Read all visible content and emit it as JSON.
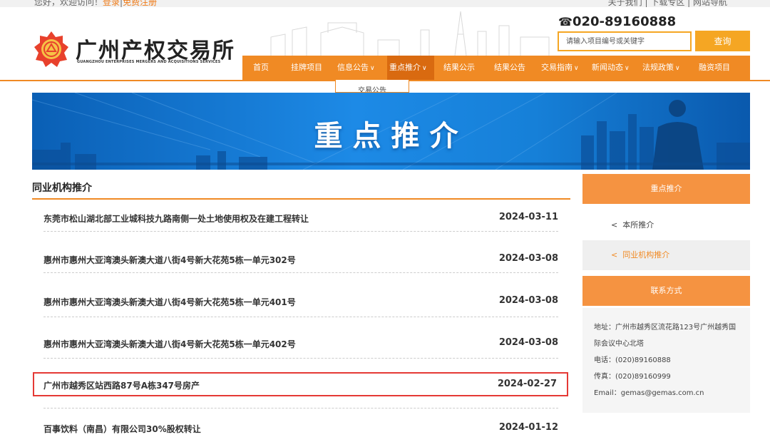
{
  "topbar": {
    "left_text": "您好，欢迎访问！",
    "left_link1": "登录",
    "left_sep": "|",
    "left_link2": "免费注册",
    "right_text": "关于我们 | 下载专区 | 网站导航"
  },
  "logo": {
    "name": "广州产权交易所",
    "subtitle": "GUANGZHOU ENTERPRISES MERGERS AND ACQUISITIONS SERVICES"
  },
  "header": {
    "phone_icon": "phone-icon",
    "phone": "020-89160888",
    "search_placeholder": "请输入项目编号或关键字",
    "search_button": "查询"
  },
  "nav": {
    "items": [
      {
        "label": "首页",
        "dropdown": false
      },
      {
        "label": "挂牌项目",
        "dropdown": false
      },
      {
        "label": "信息公告",
        "dropdown": true
      },
      {
        "label": "重点推介",
        "dropdown": true,
        "active": true
      },
      {
        "label": "结果公示",
        "dropdown": false
      },
      {
        "label": "结果公告",
        "dropdown": false
      },
      {
        "label": "交易指南",
        "dropdown": true
      },
      {
        "label": "新闻动态",
        "dropdown": true
      },
      {
        "label": "法规政策",
        "dropdown": true
      },
      {
        "label": "融资项目",
        "dropdown": false
      }
    ],
    "dropdown_item": "交易公告",
    "chevron": "∨"
  },
  "banner": {
    "title": "重点推介"
  },
  "section": {
    "title": "同业机构推介"
  },
  "list": {
    "items": [
      {
        "title": "东莞市松山湖北部工业城科技九路南侧一处土地使用权及在建工程转让",
        "date": "2024-03-11"
      },
      {
        "title": "惠州市惠州大亚湾澳头新澳大道八街4号新大花苑5栋一单元302号",
        "date": "2024-03-08"
      },
      {
        "title": "惠州市惠州大亚湾澳头新澳大道八街4号新大花苑5栋一单元401号",
        "date": "2024-03-08"
      },
      {
        "title": "惠州市惠州大亚湾澳头新澳大道八街4号新大花苑5栋一单元402号",
        "date": "2024-03-08"
      },
      {
        "title": "广州市越秀区站西路87号A栋347号房产",
        "date": "2024-02-27",
        "highlighted": true
      },
      {
        "title": "百事饮料（南昌）有限公司30%股权转让",
        "date": "2024-01-12"
      }
    ]
  },
  "sidebar": {
    "head1": "重点推介",
    "item1": "本所推介",
    "item2": "同业机构推介",
    "chevron": "<",
    "head2": "联系方式",
    "contact": {
      "address": "地址：广州市越秀区流花路123号广州越秀国际会议中心北塔",
      "phone": "电话：(020)89160888",
      "fax": "传真：(020)89160999",
      "email": "Email：gemas@gemas.com.cn"
    }
  },
  "colors": {
    "accent": "#f08a24",
    "highlight_border": "#e53935",
    "banner_blue": "#1d8ae6"
  }
}
